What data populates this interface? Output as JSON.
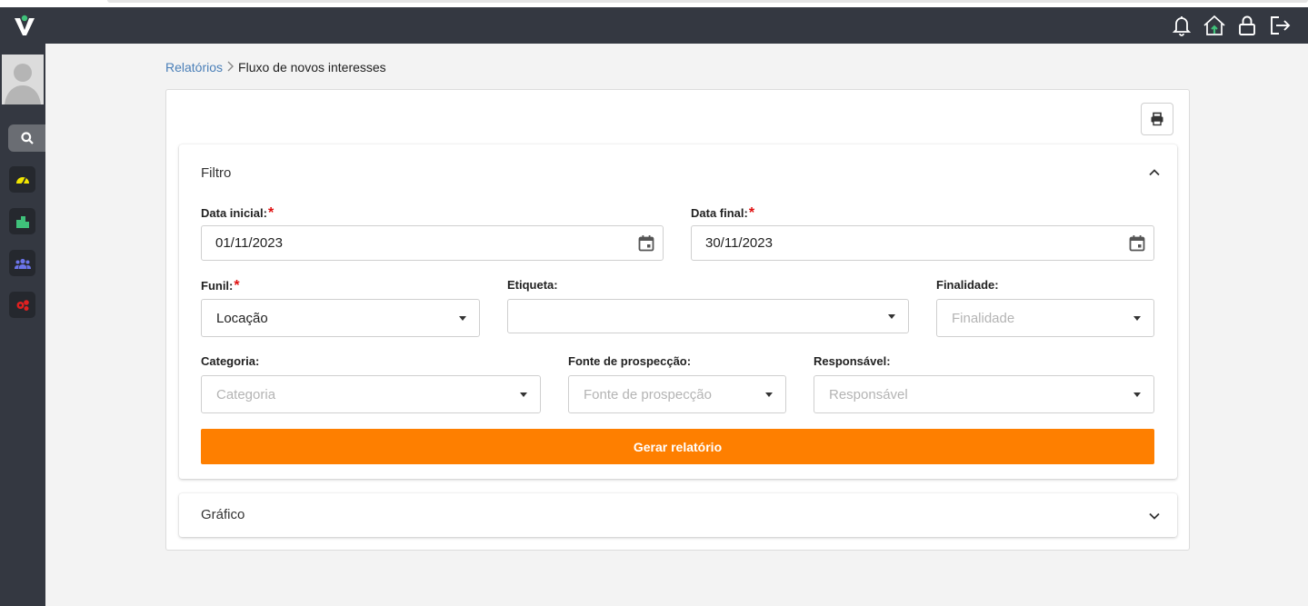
{
  "header": {
    "icons": [
      "bell-icon",
      "house-icon",
      "lock-icon",
      "logout-icon"
    ],
    "accent": "#343841"
  },
  "sidebar": {
    "items": [
      {
        "name": "search-icon",
        "color": "#ffffff"
      },
      {
        "name": "dashboard-gauge-icon",
        "color": "#f2e600"
      },
      {
        "name": "buildings-icon",
        "color": "#3fc17a"
      },
      {
        "name": "users-icon",
        "color": "#6b74e8"
      },
      {
        "name": "settings-gears-icon",
        "color": "#e02020"
      }
    ]
  },
  "breadcrumb": {
    "parent": "Relatórios",
    "current": "Fluxo de novos interesses"
  },
  "filtro": {
    "title": "Filtro",
    "data_inicial": {
      "label": "Data inicial:",
      "value": "01/11/2023"
    },
    "data_final": {
      "label": "Data final:",
      "value": "30/11/2023"
    },
    "funil": {
      "label": "Funil:",
      "value": "Locação"
    },
    "etiqueta": {
      "label": "Etiqueta:",
      "value": ""
    },
    "finalidade": {
      "label": "Finalidade:",
      "placeholder": "Finalidade"
    },
    "categoria": {
      "label": "Categoria:",
      "placeholder": "Categoria"
    },
    "fonte": {
      "label": "Fonte de prospecção:",
      "placeholder": "Fonte de prospecção"
    },
    "responsavel": {
      "label": "Responsável:",
      "placeholder": "Responsável"
    },
    "required_mark": "*",
    "submit_label": "Gerar relatório",
    "submit_color": "#fe7f00"
  },
  "grafico": {
    "title": "Gráfico"
  }
}
